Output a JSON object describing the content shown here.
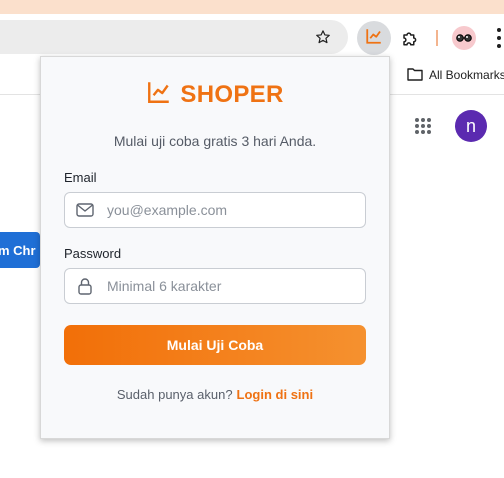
{
  "browser": {
    "bookmarks_bar": {
      "all_bookmarks_label": "All Bookmarks"
    },
    "profile_initial": "n",
    "page_button_label": "m Chr"
  },
  "popup": {
    "brand": "SHOPER",
    "subtitle": "Mulai uji coba gratis 3 hari Anda.",
    "email": {
      "label": "Email",
      "placeholder": "you@example.com",
      "value": ""
    },
    "password": {
      "label": "Password",
      "placeholder": "Minimal 6 karakter",
      "value": ""
    },
    "submit_label": "Mulai Uji Coba",
    "footer_text": "Sudah punya akun?",
    "footer_link": "Login di sini"
  },
  "colors": {
    "accent": "#ef7213",
    "button_gradient_start": "#f26f08",
    "button_gradient_end": "#f5912f",
    "avatar": "#5b2ab0",
    "page_button": "#1f6fd6"
  },
  "icons": [
    "bookmark-star-icon",
    "shoper-chart-icon",
    "extensions-puzzle-icon",
    "profile-glasses-icon",
    "more-menu-icon",
    "folder-icon",
    "apps-grid-icon",
    "mail-icon",
    "lock-icon"
  ]
}
